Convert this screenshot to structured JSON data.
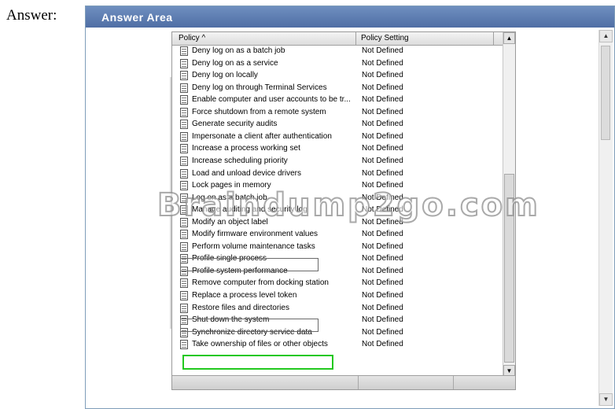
{
  "answer_label": "Answer:",
  "answer_area": {
    "title": "Answer Area"
  },
  "columns": {
    "policy": "Policy  ^",
    "setting": "Policy Setting"
  },
  "rows": [
    {
      "name": "Deny log on as a batch job",
      "setting": "Not Defined"
    },
    {
      "name": "Deny log on as a service",
      "setting": "Not Defined"
    },
    {
      "name": "Deny log on locally",
      "setting": "Not Defined"
    },
    {
      "name": "Deny log on through Terminal Services",
      "setting": "Not Defined"
    },
    {
      "name": "Enable computer and user accounts to be tr...",
      "setting": "Not Defined"
    },
    {
      "name": "Force shutdown from a remote system",
      "setting": "Not Defined"
    },
    {
      "name": "Generate security audits",
      "setting": "Not Defined"
    },
    {
      "name": "Impersonate a client after authentication",
      "setting": "Not Defined"
    },
    {
      "name": "Increase a process working set",
      "setting": "Not Defined"
    },
    {
      "name": "Increase scheduling priority",
      "setting": "Not Defined"
    },
    {
      "name": "Load and unload device drivers",
      "setting": "Not Defined"
    },
    {
      "name": "Lock pages in memory",
      "setting": "Not Defined"
    },
    {
      "name": "Log on as a batch job",
      "setting": "Not Defined"
    },
    {
      "name": "Manage auditing and security log",
      "setting": "Not Defined"
    },
    {
      "name": "Modify an object label",
      "setting": "Not Defined"
    },
    {
      "name": "Modify firmware environment values",
      "setting": "Not Defined"
    },
    {
      "name": "Perform volume maintenance tasks",
      "setting": "Not Defined"
    },
    {
      "name": "Profile single process",
      "setting": "Not Defined"
    },
    {
      "name": "Profile system performance",
      "setting": "Not Defined"
    },
    {
      "name": "Remove computer from docking station",
      "setting": "Not Defined"
    },
    {
      "name": "Replace a process level token",
      "setting": "Not Defined"
    },
    {
      "name": "Restore files and directories",
      "setting": "Not Defined"
    },
    {
      "name": "Shut down the system",
      "setting": "Not Defined"
    },
    {
      "name": "Synchronize directory service data",
      "setting": "Not Defined"
    },
    {
      "name": "Take ownership of files or other objects",
      "setting": "Not Defined"
    }
  ],
  "watermark": "Braindump2go.com",
  "highlight_color": "#22c81e"
}
